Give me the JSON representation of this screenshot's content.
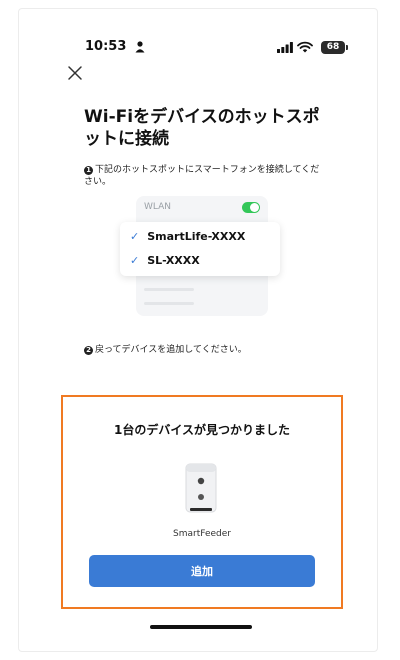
{
  "status_bar": {
    "time": "10:53",
    "battery": "68",
    "icons": [
      "person-icon",
      "signal-icon",
      "wifi-icon",
      "battery-icon"
    ]
  },
  "header": {
    "close_icon": "close-icon",
    "title": "Wi-Fiをデバイスのホットスポットに接続"
  },
  "steps": [
    {
      "number": "1",
      "text": "下記のホットスポットにスマートフォンを接続してください。"
    },
    {
      "number": "2",
      "text": "戻ってデバイスを追加してください。"
    }
  ],
  "wlan": {
    "label": "WLAN",
    "toggle_on": true,
    "networks": [
      {
        "check": "✓",
        "name": "SmartLife-XXXX"
      },
      {
        "check": "✓",
        "name": "SL-XXXX"
      }
    ]
  },
  "found": {
    "title": "1台のデバイスが見つかりました",
    "device_icon": "pet-feeder-icon",
    "device_name": "SmartFeeder",
    "add_label": "追加"
  },
  "colors": {
    "accent": "#3a7bd5",
    "highlight_border": "#f07a22",
    "toggle": "#34c759"
  }
}
